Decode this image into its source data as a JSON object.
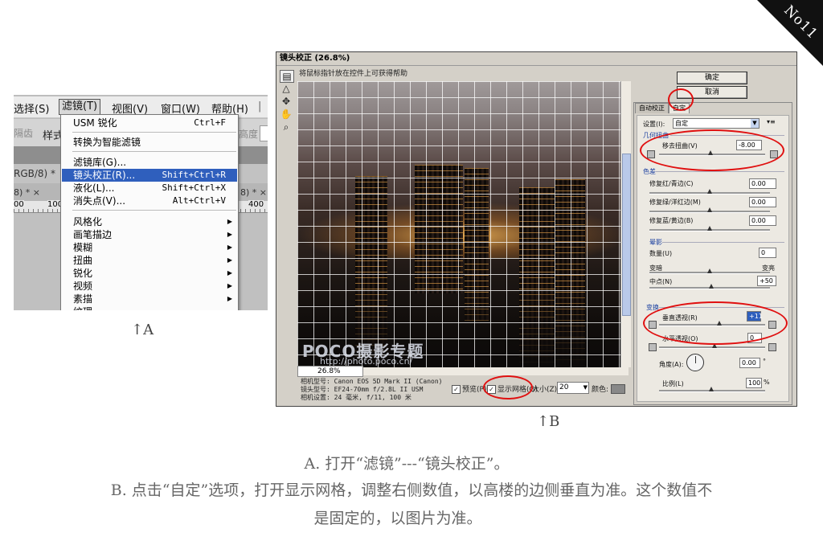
{
  "corner_label": "No11",
  "panel_a": {
    "menubar": [
      "选择(S)",
      "滤镜(T)",
      "视图(V)",
      "窗口(W)",
      "帮助(H)"
    ],
    "options_left": "隔齿",
    "options_style": "样式",
    "options_right": "高度",
    "doc_tab_1": "RGB/8) *",
    "doc_tab_2": "8) * ×",
    "doc_tab_3": "8) * ×",
    "ruler_left_1": "00",
    "ruler_left_2": "100",
    "ruler_right": "400",
    "menu_items": [
      {
        "label": "USM 锐化",
        "shortcut": "Ctrl+F"
      },
      {
        "label": "转换为智能滤镜",
        "shortcut": ""
      },
      {
        "label": "滤镜库(G)...",
        "shortcut": ""
      },
      {
        "label": "镜头校正(R)...",
        "shortcut": "Shift+Ctrl+R"
      },
      {
        "label": "液化(L)...",
        "shortcut": "Shift+Ctrl+X"
      },
      {
        "label": "消失点(V)...",
        "shortcut": "Alt+Ctrl+V"
      },
      {
        "label": "风格化",
        "shortcut": ""
      },
      {
        "label": "画笔描边",
        "shortcut": ""
      },
      {
        "label": "模糊",
        "shortcut": ""
      },
      {
        "label": "扭曲",
        "shortcut": ""
      },
      {
        "label": "锐化",
        "shortcut": ""
      },
      {
        "label": "视频",
        "shortcut": ""
      },
      {
        "label": "素描",
        "shortcut": ""
      },
      {
        "label": "纹理",
        "shortcut": ""
      }
    ],
    "caption": "↑A"
  },
  "panel_b": {
    "title": "镜头校正 (26.8%)",
    "hint": "将鼠标指针放在控件上可获得帮助",
    "zoom": "26.8%",
    "watermark_1": "POCO摄影专题",
    "watermark_2": "http://photo.poco.cn/",
    "meta": [
      "相机型号: Canon EOS 5D Mark II (Canon)",
      "镜头型号: EF24-70mm f/2.8L II USM",
      "相机设置: 24 毫米, f/11, 100 米"
    ],
    "preview_label": "预览(P)",
    "show_grid_label": "显示网格(G)",
    "size_label": "大小(Z):",
    "size_value": "20",
    "color_label": "颜色:",
    "ok_button": "确定",
    "cancel_button": "取消",
    "tab_auto": "自动校正",
    "tab_custom": "自定",
    "settings_label": "设置(I):",
    "settings_value": "自定",
    "geometry_section": "几何扭曲",
    "remove_distortion_label": "移去扭曲(V)",
    "remove_distortion_value": "-8.00",
    "chromatic_section": "色差",
    "fix_red_cyan_label": "修复红/青边(C)",
    "fix_red_cyan_value": "0.00",
    "fix_green_magenta_label": "修复绿/洋红边(M)",
    "fix_green_magenta_value": "0.00",
    "fix_blue_yellow_label": "修复蓝/黄边(B)",
    "fix_blue_yellow_value": "0.00",
    "vignette_section": "晕影",
    "amount_label": "数量(U)",
    "amount_value": "0",
    "darken_label": "变暗",
    "lighten_label": "变亮",
    "midpoint_label": "中点(N)",
    "midpoint_value": "+50",
    "transform_section": "变换",
    "vertical_perspective_label": "垂直透视(R)",
    "vertical_perspective_value": "+11",
    "horizontal_perspective_label": "水平透视(O)",
    "horizontal_perspective_value": "0",
    "angle_label": "角度(A):",
    "angle_value": "0.00",
    "angle_unit": "°",
    "scale_label": "比例(L)",
    "scale_value": "100",
    "scale_unit": "%",
    "caption": "↑B"
  },
  "captions": {
    "line1": "A. 打开“滤镜”---“镜头校正”。",
    "line2": "B. 点击“自定”选项，打开显示网格，调整右侧数值，以高楼的边侧垂直为准。这个数值不",
    "line3": "是固定的，以图片为准。"
  },
  "colors": {
    "highlight": "#e01010",
    "menu_selection": "#2f5fbd"
  }
}
